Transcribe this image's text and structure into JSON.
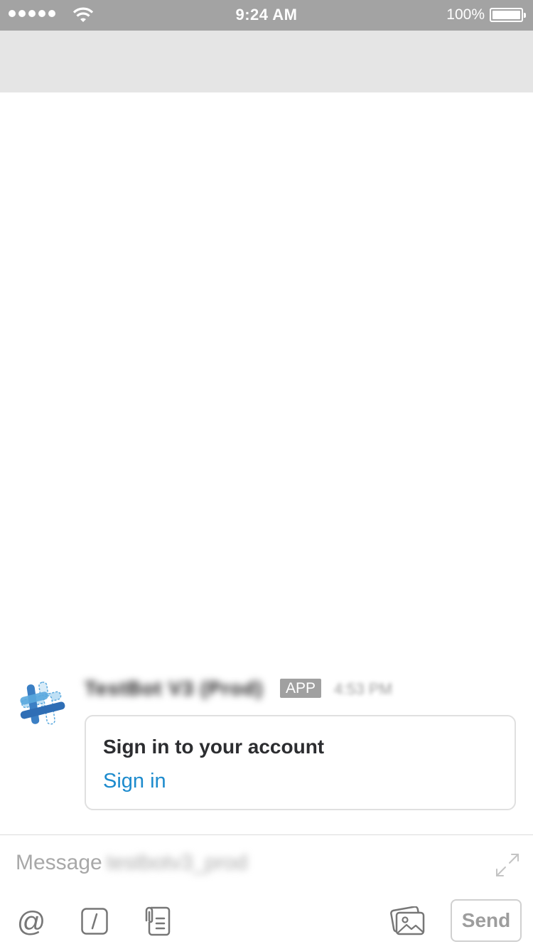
{
  "status_bar": {
    "time": "9:24 AM",
    "battery_percent": "100%",
    "signal_bars": 5,
    "wifi_icon": "wifi-icon",
    "battery_level": 1.0
  },
  "message": {
    "sender": "TestBot V3 (Prod)",
    "badge": "APP",
    "timestamp": "4:53 PM",
    "avatar_icon": "slack-hash-icon",
    "attachment": {
      "title": "Sign in to your account",
      "link_label": "Sign in"
    }
  },
  "composer": {
    "placeholder": "Message",
    "channel": "testbotv3_prod",
    "send_label": "Send",
    "icons": [
      "at-icon",
      "slash-command-icon",
      "files-icon",
      "photo-icon",
      "expand-icon"
    ]
  },
  "colors": {
    "status_bar": "#a3a3a3",
    "header_band": "#e5e5e5",
    "link": "#1d8bcd",
    "badge": "#a0a0a0"
  }
}
